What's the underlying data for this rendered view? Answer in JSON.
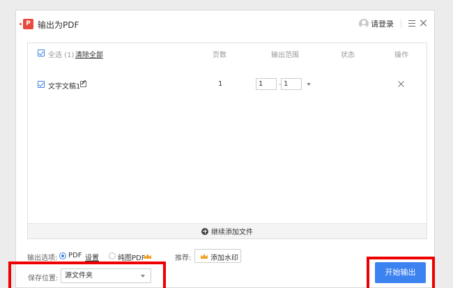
{
  "window": {
    "title": "输出为PDF",
    "login_label": "请登录"
  },
  "file_list": {
    "select_all": "全选 (1)",
    "clear_all": "清除全部",
    "columns": {
      "pages": "页数",
      "range": "输出范围",
      "status": "状态",
      "action": "操作"
    },
    "rows": [
      {
        "name": "文字文稿1",
        "pages": "1",
        "range_from": "1",
        "range_to": "1",
        "range_sep": "-",
        "status": ""
      }
    ],
    "add_more": "继续添加文件"
  },
  "options": {
    "label": "输出选项:",
    "choices": [
      {
        "label": "PDF",
        "selected": true
      },
      {
        "label": "纯图PDF",
        "selected": false,
        "premium": true
      }
    ],
    "settings_link": "设置",
    "recommend_label": "推荐:",
    "watermark_button": "添加水印"
  },
  "save": {
    "label": "保存位置:",
    "value": "源文件夹"
  },
  "start_button": "开始输出",
  "colors": {
    "accent": "#3c82f0",
    "highlight": "#ee0000",
    "premium": "#f0a020"
  }
}
